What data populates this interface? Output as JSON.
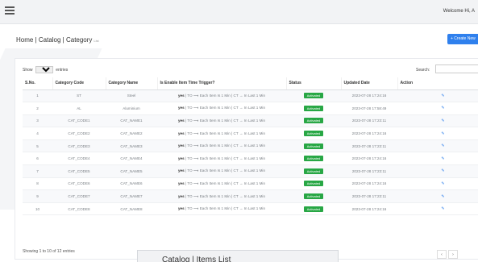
{
  "topbar": {
    "welcome": "Welcome Hi, A"
  },
  "breadcrumb": {
    "text": "Home | Catalog | Category",
    "sub": "List"
  },
  "create_button": "+ Create New",
  "controls": {
    "show_prefix": "Show",
    "show_value": "10",
    "show_suffix": "entries",
    "search_label": "Search:",
    "search_value": ""
  },
  "table": {
    "headers": [
      "S.No.",
      "Category Code",
      "Category Name",
      "Is Enable Item Time Trigger?",
      "Status",
      "Updated Date",
      "Action"
    ],
    "trigger_label": "yes",
    "trigger_text": " | TO ⟶ Each Item Is 1 Min | CT → In Last 1 Min",
    "rows": [
      {
        "sno": "1",
        "code": "ST",
        "name": "Steel",
        "status": "Activated",
        "date": "2023-07-28 17:24:16"
      },
      {
        "sno": "2",
        "code": "AL",
        "name": "Aluminium",
        "status": "Activated",
        "date": "2023-07-28 17:58:49"
      },
      {
        "sno": "3",
        "code": "CAT_CODE1",
        "name": "CAT_NAME1",
        "status": "Activated",
        "date": "2023-07-28 17:23:11"
      },
      {
        "sno": "4",
        "code": "CAT_CODE2",
        "name": "CAT_NAME2",
        "status": "Activated",
        "date": "2023-07-28 17:24:16"
      },
      {
        "sno": "5",
        "code": "CAT_CODE3",
        "name": "CAT_NAME3",
        "status": "Activated",
        "date": "2023-07-28 17:23:11"
      },
      {
        "sno": "6",
        "code": "CAT_CODE4",
        "name": "CAT_NAME4",
        "status": "Activated",
        "date": "2023-07-28 17:24:16"
      },
      {
        "sno": "7",
        "code": "CAT_CODE5",
        "name": "CAT_NAME5",
        "status": "Activated",
        "date": "2023-07-28 17:23:11"
      },
      {
        "sno": "8",
        "code": "CAT_CODE6",
        "name": "CAT_NAME6",
        "status": "Activated",
        "date": "2023-07-28 17:24:16"
      },
      {
        "sno": "9",
        "code": "CAT_CODE7",
        "name": "CAT_NAME7",
        "status": "Activated",
        "date": "2023-07-28 17:23:11"
      },
      {
        "sno": "10",
        "code": "CAT_CODE8",
        "name": "CAT_NAME8",
        "status": "Activated",
        "date": "2023-07-28 17:24:16"
      }
    ]
  },
  "footer": {
    "info": "Showing 1 to 10 of 12 entries",
    "prev": "‹",
    "next": "›"
  },
  "popup": {
    "title": "Catalog | Items List"
  },
  "colors": {
    "accent": "#2f80ed",
    "status_green": "#28a745"
  }
}
